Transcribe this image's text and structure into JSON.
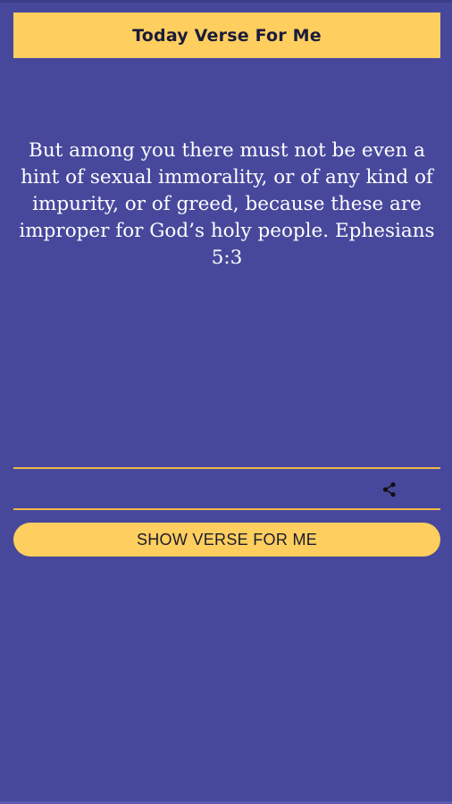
{
  "header": {
    "title": "Today Verse For Me"
  },
  "verse": {
    "text": "But among you there must not be even a hint of sexual immorality, or of any kind of impurity, or of greed, because these are improper for God’s holy people. Ephesians 5:3"
  },
  "actions": {
    "share_icon": "share-icon",
    "show_button_label": "SHOW VERSE FOR ME"
  },
  "colors": {
    "background": "#47489c",
    "accent": "#fece5e",
    "divider": "#f0b847",
    "text_light": "#ffffff",
    "text_dark": "#1b1b3a"
  }
}
